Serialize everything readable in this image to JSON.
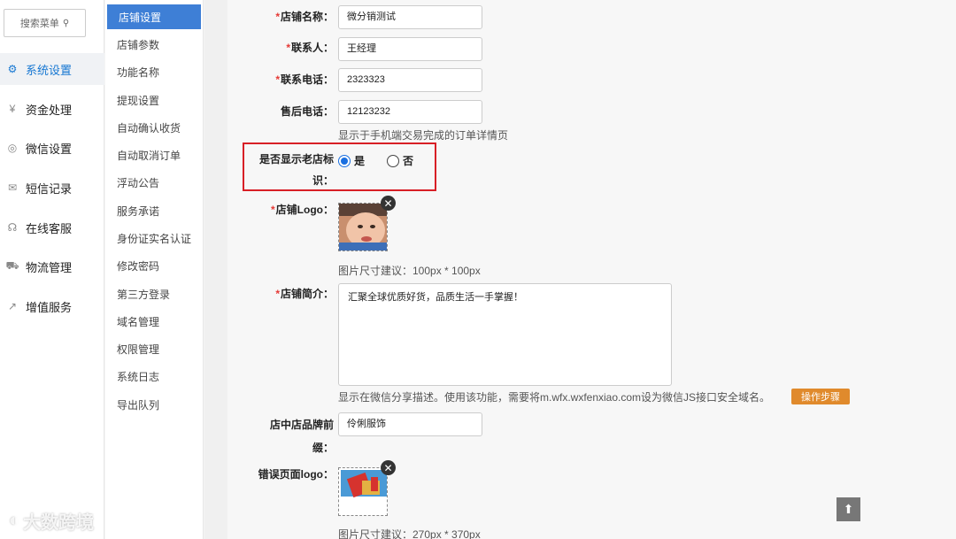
{
  "sidebar": {
    "search_placeholder": "搜索菜单",
    "items": [
      {
        "label": "系统设置",
        "icon": "gear-icon"
      },
      {
        "label": "资金处理",
        "icon": "yen-icon"
      },
      {
        "label": "微信设置",
        "icon": "wechat-icon"
      },
      {
        "label": "短信记录",
        "icon": "mail-icon"
      },
      {
        "label": "在线客服",
        "icon": "headset-icon"
      },
      {
        "label": "物流管理",
        "icon": "truck-icon"
      },
      {
        "label": "增值服务",
        "icon": "chart-icon"
      }
    ]
  },
  "subnav": {
    "items": [
      "店铺设置",
      "店铺参数",
      "功能名称",
      "提现设置",
      "自动确认收货",
      "自动取消订单",
      "浮动公告",
      "服务承诺",
      "身份证实名认证",
      "修改密码",
      "第三方登录",
      "域名管理",
      "权限管理",
      "系统日志",
      "导出队列"
    ]
  },
  "form": {
    "shop_name": {
      "label": "店铺名称：",
      "value": "微分销测试"
    },
    "contact": {
      "label": "联系人：",
      "value": "王经理"
    },
    "phone": {
      "label": "联系电话：",
      "value": "2323323"
    },
    "after_sale_phone": {
      "label": "售后电话：",
      "value": "12123232",
      "hint": "显示于手机端交易完成的订单详情页"
    },
    "old_shop": {
      "label_line1": "是否显示老店标",
      "label_line2": "识：",
      "yes": "是",
      "no": "否"
    },
    "logo": {
      "label": "店铺Logo：",
      "hint": "图片尺寸建议：100px * 100px"
    },
    "intro": {
      "label": "店铺简介：",
      "value": "汇聚全球优质好货，品质生活一手掌握！",
      "hint": "显示在微信分享描述。使用该功能，需要将m.wfx.wxfenxiao.com设为微信JS接口安全域名。",
      "button": "操作步骤"
    },
    "brand_prefix": {
      "label_line1": "店中店品牌前",
      "label_line2": "缀：",
      "value": "伶俐服饰"
    },
    "error_logo": {
      "label": "错误页面logo：",
      "hint": "图片尺寸建议：270px * 370px"
    }
  },
  "required_mark": "*",
  "watermark": "大数跨境",
  "colors": {
    "accent": "#3e7fd6",
    "required": "#e53935",
    "highlight": "#d81f26",
    "button": "#e08a2c"
  }
}
